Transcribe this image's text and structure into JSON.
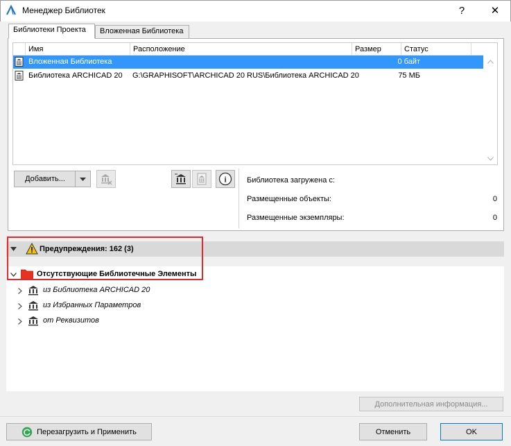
{
  "window": {
    "title": "Менеджер Библиотек",
    "help_glyph": "?",
    "close_glyph": "✕"
  },
  "tabs": [
    {
      "label": "Библиотеки Проекта",
      "active": true
    },
    {
      "label": "Вложенная Библиотека",
      "active": false
    }
  ],
  "table": {
    "columns": [
      "Имя",
      "Расположение",
      "Размер",
      "Статус"
    ],
    "rows": [
      {
        "name": "Вложенная Библиотека",
        "location": "",
        "size": "0 байт",
        "status": "",
        "selected": true
      },
      {
        "name": "Библиотека ARCHICAD 20",
        "location": "G:\\GRAPHISOFT\\ARCHICAD 20 RUS\\Библиотека ARCHICAD 20",
        "size": "75 МБ",
        "status": "",
        "selected": false
      }
    ]
  },
  "toolbar": {
    "add_label": "Добавить...",
    "info_glyph": "i"
  },
  "info": {
    "loaded_from_label": "Библиотека загружена с:",
    "placed_objects_label": "Размещенные объекты:",
    "placed_objects_value": "0",
    "placed_instances_label": "Размещенные экземпляры:",
    "placed_instances_value": "0"
  },
  "warnings": {
    "header": "Предупреждения: 162 (3)",
    "missing_group": "Отсутствующие Библиотечные Элементы",
    "items": [
      "из Библиотека ARCHICAD 20",
      "из Избранных Параметров",
      "от Реквизитов"
    ]
  },
  "buttons": {
    "more_info": "Дополнительная информация...",
    "reload_apply": "Перезагрузить и Применить",
    "cancel": "Отменить",
    "ok": "OK"
  },
  "colors": {
    "selection": "#3297fd",
    "warning_yellow": "#f5c400",
    "folder_red": "#e8321e",
    "highlight_red": "#e8262c"
  }
}
